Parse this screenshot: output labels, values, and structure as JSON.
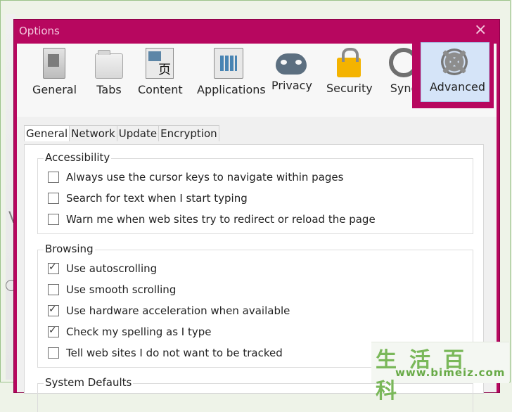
{
  "window": {
    "title": "Options",
    "close_glyph": "×"
  },
  "toolbar": {
    "items": [
      {
        "label": "General",
        "icon": "general-switch-icon"
      },
      {
        "label": "Tabs",
        "icon": "tabs-icon"
      },
      {
        "label": "Content",
        "icon": "content-icon"
      },
      {
        "label": "Applications",
        "icon": "applications-icon"
      },
      {
        "label": "Privacy",
        "icon": "privacy-mask-icon"
      },
      {
        "label": "Security",
        "icon": "lock-icon"
      },
      {
        "label": "Sync",
        "icon": "sync-icon"
      },
      {
        "label": "Advanced",
        "icon": "gear-icon",
        "selected": true,
        "highlight_color": "#b7075f"
      }
    ]
  },
  "subtabs": [
    "General",
    "Network",
    "Update",
    "Encryption"
  ],
  "sections": {
    "accessibility": {
      "title": "Accessibility",
      "options": [
        {
          "label": "Always use the cursor keys to navigate within pages",
          "checked": false
        },
        {
          "label": "Search for text when I start typing",
          "checked": false
        },
        {
          "label": "Warn me when web sites try to redirect or reload the page",
          "checked": false
        }
      ]
    },
    "browsing": {
      "title": "Browsing",
      "options": [
        {
          "label": "Use autoscrolling",
          "checked": true
        },
        {
          "label": "Use smooth scrolling",
          "checked": false
        },
        {
          "label": "Use hardware acceleration when available",
          "checked": true
        },
        {
          "label": "Check my spelling as I type",
          "checked": true
        },
        {
          "label": "Tell web sites I do not want to be tracked",
          "checked": false
        }
      ]
    },
    "system_defaults": {
      "title": "System Defaults"
    }
  },
  "watermark": {
    "chinese": "生活百科",
    "url": "www.bimeiz.com"
  },
  "colors": {
    "accent": "#b7075f",
    "selected_bg": "#d5e4f8",
    "watermark": "#7ab85a"
  }
}
